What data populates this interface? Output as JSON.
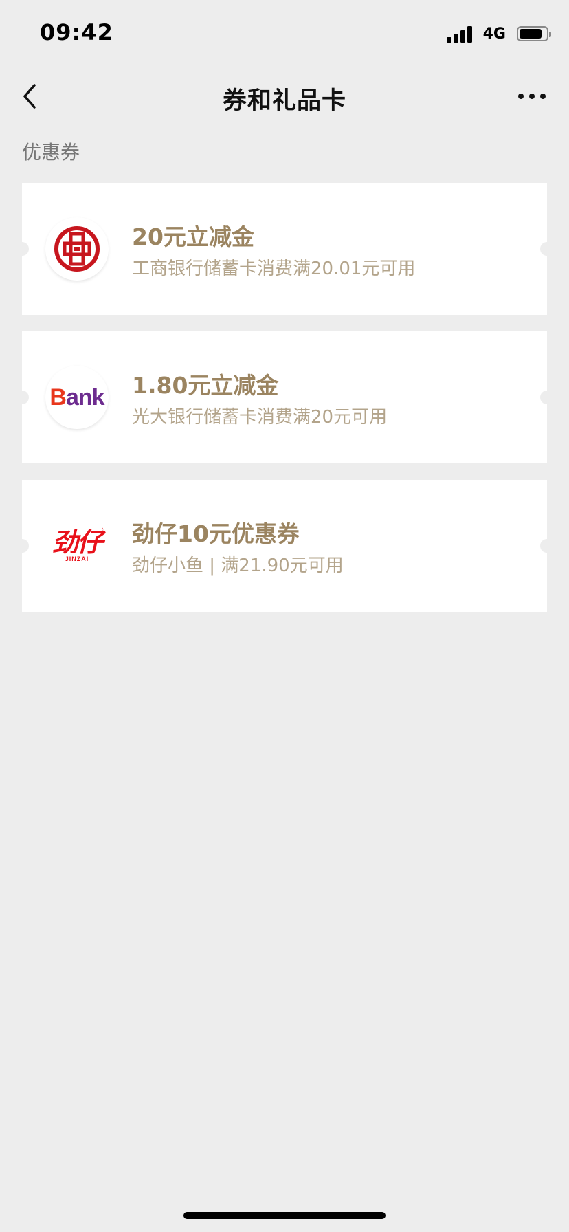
{
  "status_bar": {
    "time": "09:42",
    "network": "4G",
    "battery_level": 0.85
  },
  "nav": {
    "title": "券和礼品卡"
  },
  "section": {
    "label": "优惠券"
  },
  "coupons": [
    {
      "title": "20元立减金",
      "desc": "工商银行储蓄卡消费满20.01元可用",
      "logo": "icbc-logo-icon"
    },
    {
      "title": "1.80元立减金",
      "desc": "光大银行储蓄卡消费满20元可用",
      "logo": "bank-logo-icon",
      "logo_text_first": "B",
      "logo_text_rest": "ank"
    },
    {
      "title": "劲仔10元优惠券",
      "desc": "劲仔小鱼 | 满21.90元可用",
      "logo": "jinzai-logo-icon",
      "logo_text_cn": "劲仔",
      "logo_text_en": "JINZAI",
      "logo_reg": "®"
    }
  ],
  "colors": {
    "background": "#ededed",
    "coupon_title": "#9b8460",
    "coupon_desc": "#b3a48b",
    "icbc_red": "#c7161e",
    "jinzai_red": "#e8111a"
  }
}
